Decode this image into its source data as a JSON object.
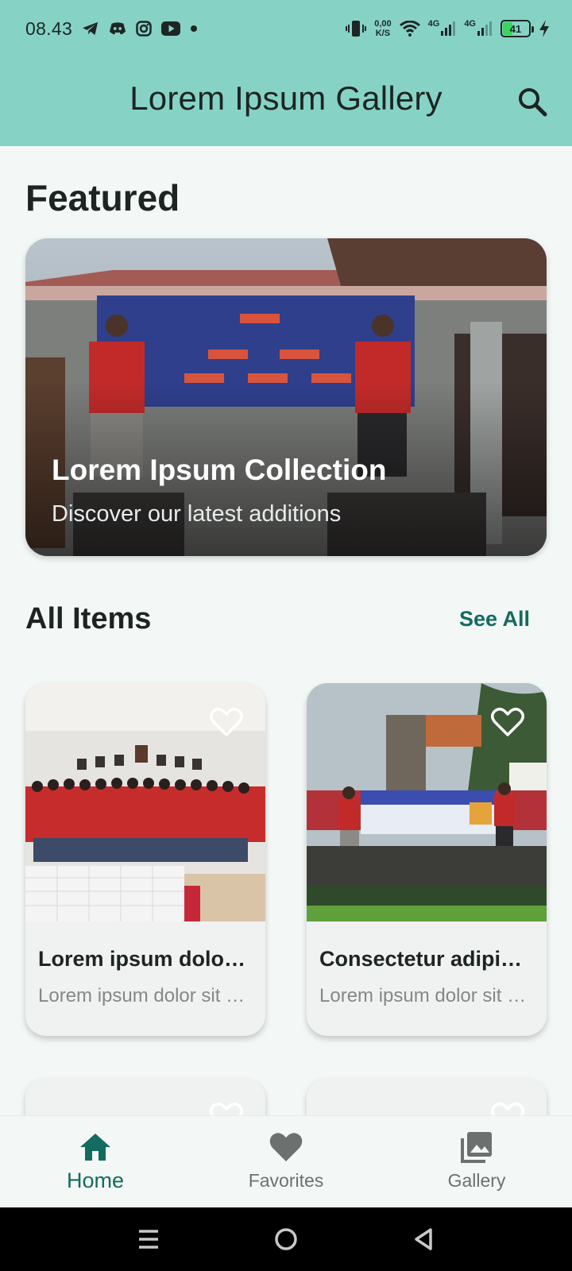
{
  "status_bar": {
    "time": "08.43",
    "net_speed_value": "0,00",
    "net_speed_unit": "K/S",
    "sim1_label": "4G",
    "sim2_label": "4G",
    "battery_level": "41",
    "left_icons": [
      "telegram-icon",
      "discord-icon",
      "instagram-icon",
      "youtube-icon",
      "notification-dot-icon"
    ],
    "right_icons": [
      "vibrate-icon",
      "wifi-icon",
      "signal-icon",
      "signal-icon",
      "battery-icon",
      "charging-icon"
    ]
  },
  "app_bar": {
    "title": "Lorem Ipsum Gallery",
    "search_icon": "search-icon",
    "background": "#86d3c6"
  },
  "featured": {
    "section_title": "Featured",
    "card": {
      "title": "Lorem Ipsum Collection",
      "subtitle": "Discover our latest additions"
    }
  },
  "all_items": {
    "section_title": "All Items",
    "see_all_label": "See All",
    "items": [
      {
        "title": "Lorem ipsum dolor sit amet",
        "description": "Lorem ipsum dolor sit amet, consectetur",
        "favorite_icon": "heart-outline-icon"
      },
      {
        "title": "Consectetur adipiscing elit",
        "description": "Lorem ipsum dolor sit amet, consectetur",
        "favorite_icon": "heart-outline-icon"
      },
      {
        "title": "",
        "description": "",
        "favorite_icon": "heart-outline-icon"
      },
      {
        "title": "",
        "description": "",
        "favorite_icon": "heart-outline-icon"
      }
    ]
  },
  "bottom_nav": {
    "items": [
      {
        "label": "Home",
        "icon": "home-icon",
        "active": true
      },
      {
        "label": "Favorites",
        "icon": "heart-icon",
        "active": false
      },
      {
        "label": "Gallery",
        "icon": "gallery-icon",
        "active": false
      }
    ],
    "accent": "#146b60"
  },
  "system_nav": {
    "icons": [
      "recents-icon",
      "home-circle-icon",
      "back-icon"
    ]
  }
}
